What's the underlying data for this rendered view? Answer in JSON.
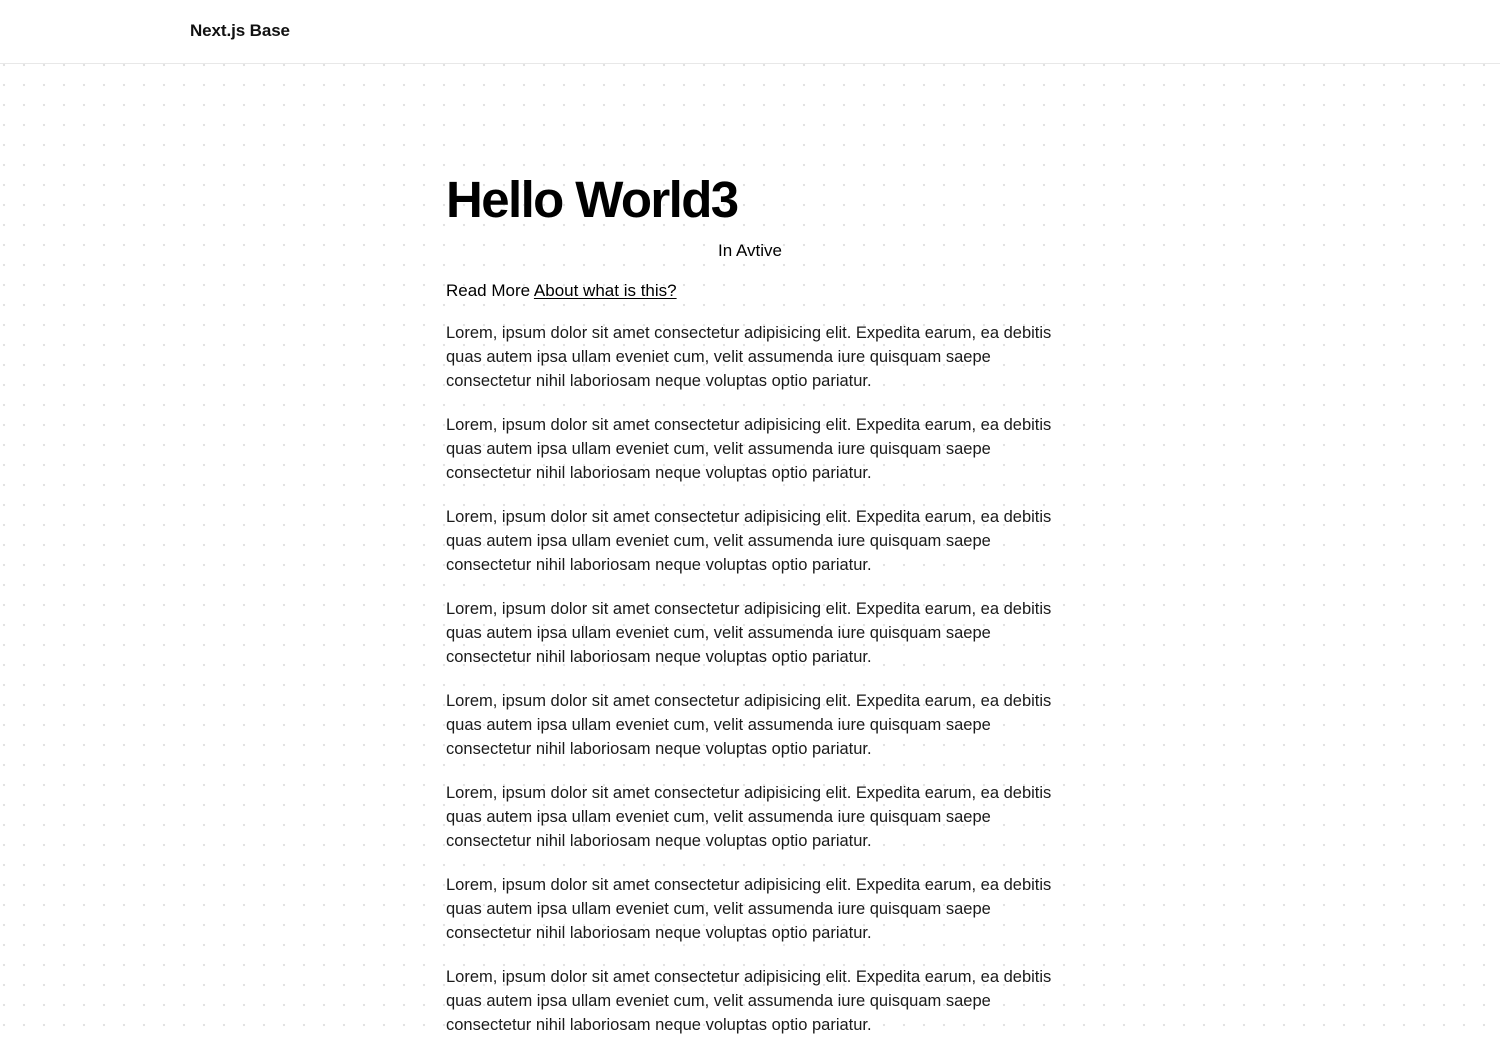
{
  "header": {
    "brand": "Next.js Base"
  },
  "main": {
    "title": "Hello World3",
    "status": "In Avtive",
    "read_more_prefix": "Read More",
    "read_more_link": "About what is this?",
    "paragraphs": [
      "Lorem, ipsum dolor sit amet consectetur adipisicing elit. Expedita earum, ea debitis quas autem ipsa ullam eveniet cum, velit assumenda iure quisquam saepe consectetur nihil laboriosam neque voluptas optio pariatur.",
      "Lorem, ipsum dolor sit amet consectetur adipisicing elit. Expedita earum, ea debitis quas autem ipsa ullam eveniet cum, velit assumenda iure quisquam saepe consectetur nihil laboriosam neque voluptas optio pariatur.",
      "Lorem, ipsum dolor sit amet consectetur adipisicing elit. Expedita earum, ea debitis quas autem ipsa ullam eveniet cum, velit assumenda iure quisquam saepe consectetur nihil laboriosam neque voluptas optio pariatur.",
      "Lorem, ipsum dolor sit amet consectetur adipisicing elit. Expedita earum, ea debitis quas autem ipsa ullam eveniet cum, velit assumenda iure quisquam saepe consectetur nihil laboriosam neque voluptas optio pariatur.",
      "Lorem, ipsum dolor sit amet consectetur adipisicing elit. Expedita earum, ea debitis quas autem ipsa ullam eveniet cum, velit assumenda iure quisquam saepe consectetur nihil laboriosam neque voluptas optio pariatur.",
      "Lorem, ipsum dolor sit amet consectetur adipisicing elit. Expedita earum, ea debitis quas autem ipsa ullam eveniet cum, velit assumenda iure quisquam saepe consectetur nihil laboriosam neque voluptas optio pariatur.",
      "Lorem, ipsum dolor sit amet consectetur adipisicing elit. Expedita earum, ea debitis quas autem ipsa ullam eveniet cum, velit assumenda iure quisquam saepe consectetur nihil laboriosam neque voluptas optio pariatur.",
      "Lorem, ipsum dolor sit amet consectetur adipisicing elit. Expedita earum, ea debitis quas autem ipsa ullam eveniet cum, velit assumenda iure quisquam saepe consectetur nihil laboriosam neque voluptas optio pariatur."
    ]
  },
  "colors": {
    "background": "#ffffff",
    "text": "#111111",
    "dot_grid": "#e2e2e2",
    "header_border": "#e8e8e8"
  }
}
